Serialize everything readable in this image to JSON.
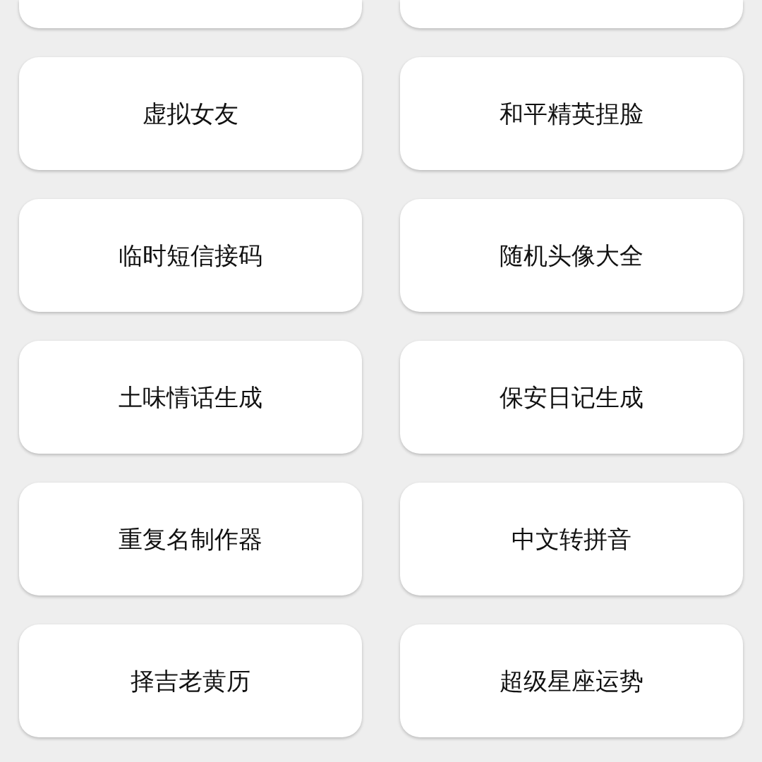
{
  "cards": [
    {
      "cut_off": true
    },
    {
      "cut_off": true
    },
    {
      "label": "虚拟女友",
      "cut_off": false
    },
    {
      "label": "和平精英捏脸",
      "cut_off": false
    },
    {
      "label": "临时短信接码",
      "cut_off": false
    },
    {
      "label": "随机头像大全",
      "cut_off": false
    },
    {
      "label": "土味情话生成",
      "cut_off": false
    },
    {
      "label": "保安日记生成",
      "cut_off": false
    },
    {
      "label": "重复名制作器",
      "cut_off": false
    },
    {
      "label": "中文转拼音",
      "cut_off": false
    },
    {
      "label": "择吉老黄历",
      "cut_off": false
    },
    {
      "label": "超级星座运势",
      "cut_off": false
    }
  ]
}
